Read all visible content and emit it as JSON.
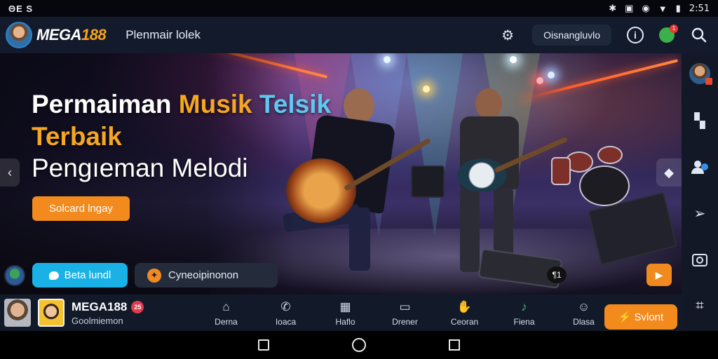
{
  "status_bar": {
    "left_text": "ΘΕ S",
    "time": "2:51",
    "icons": [
      "bluetooth-icon",
      "nfc-icon",
      "alarm-icon",
      "wifi-icon",
      "battery-icon"
    ]
  },
  "header": {
    "brand_prefix": "MEGA",
    "brand_number": "188",
    "subtitle": "Plenmair lolek",
    "pill_button": "Oisnangluvlo",
    "notification_count": "1",
    "icons": [
      "settings-icon",
      "info-icon",
      "notification-icon",
      "search-icon"
    ]
  },
  "hero": {
    "title_word1": "Permaiman ",
    "title_word2": "Musik",
    "title_word3": " Telsik",
    "title_line2": "Terbaik",
    "title_line3": "Pengıeman Melodi",
    "cta_label": "Solcard lngay",
    "twitter_button": "Beta lundl",
    "secondary_button": "Cyneoipinonon",
    "pedal_badge": "¶1"
  },
  "right_bar": {
    "icons": [
      "profile-avatar",
      "map-icon",
      "users-icon",
      "send-icon",
      "camera-icon",
      "share-icon"
    ]
  },
  "bottom_bar": {
    "brand": "MEGA188",
    "badge": "25",
    "subtitle": "Goolmiemon",
    "nav": [
      {
        "label": "Derna",
        "icon": "home-icon"
      },
      {
        "label": "Ioaca",
        "icon": "phone-icon"
      },
      {
        "label": "Haflo",
        "icon": "grid-icon"
      },
      {
        "label": "Drener",
        "icon": "tv-icon"
      },
      {
        "label": "Ceoran",
        "icon": "hand-icon"
      },
      {
        "label": "Fiena",
        "icon": "music-icon"
      },
      {
        "label": "Dlasa",
        "icon": "user-icon"
      }
    ],
    "cta_label": "Svlont"
  },
  "colors": {
    "accent_orange": "#f28a1d",
    "accent_cyan": "#1ab2e6",
    "header_bg": "#121a2c"
  }
}
